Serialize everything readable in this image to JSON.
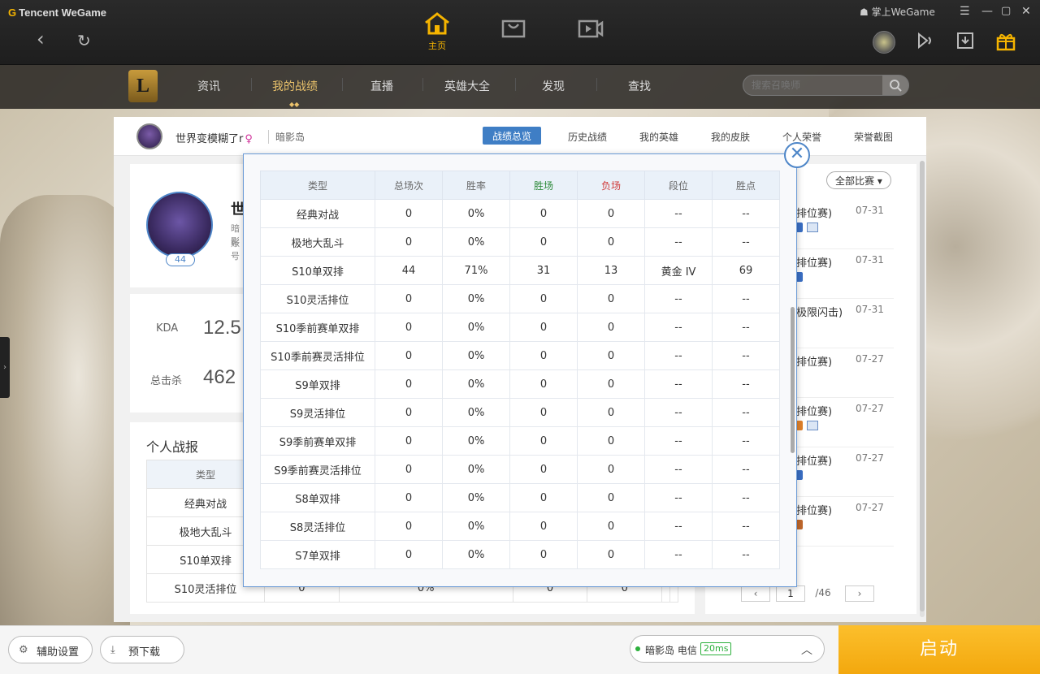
{
  "app": {
    "title": "Tencent WeGame",
    "brand_color": "#f5b400"
  },
  "topnav": {
    "home_label": "主页",
    "user_label": "掌上WeGame"
  },
  "lolnav": {
    "logo_letter": "L",
    "items": [
      "资讯",
      "我的战绩",
      "直播",
      "英雄大全",
      "发现",
      "查找"
    ],
    "active": "我的战绩",
    "search_placeholder": "搜索召唤师"
  },
  "profile": {
    "name": "世界变模糊了r",
    "gender_symbol": "♀",
    "server": "暗影岛",
    "level": "44",
    "name_partial": "世",
    "server_partial": "暗影",
    "account_partial": "账号"
  },
  "subtabs": [
    "战绩总览",
    "历史战绩",
    "我的英雄",
    "我的皮肤",
    "个人荣誉",
    "荣誉截图"
  ],
  "stats": {
    "kda_label": "KDA",
    "kda_value": "12.5",
    "kills_label": "总击杀",
    "kills_value": "462"
  },
  "report": {
    "title": "个人战报",
    "header": "类型",
    "rows": [
      {
        "type": "经典对战",
        "c1": "",
        "c2": "",
        "c3": "",
        "c4": "",
        "c5": "",
        "c6": ""
      },
      {
        "type": "极地大乱斗",
        "c1": "",
        "c2": "",
        "c3": "",
        "c4": "",
        "c5": "",
        "c6": ""
      },
      {
        "type": "S10单双排",
        "c1": "",
        "c2": "",
        "c3": "",
        "c4": "",
        "c5": "",
        "c6": ""
      },
      {
        "type": "S10灵活排位",
        "c1": "0",
        "c2": "0%",
        "c3": "0",
        "c4": "0",
        "c5": "",
        "c6": ""
      }
    ]
  },
  "matches": {
    "filter": "全部比赛",
    "rows": [
      {
        "mode": "排位赛)",
        "date": "07-31",
        "tag_color": "#3a6fc4",
        "has_img": true
      },
      {
        "mode": "排位赛)",
        "date": "07-31",
        "tag_color": "#3a6fc4",
        "has_img": false
      },
      {
        "mode": "极限闪击)",
        "date": "07-31",
        "tag_color": "",
        "has_img": false
      },
      {
        "mode": "排位赛)",
        "date": "07-27",
        "tag_color": "",
        "has_img": false
      },
      {
        "mode": "排位赛)",
        "date": "07-27",
        "tag_color": "#e0822c",
        "has_img": true
      },
      {
        "mode": "排位赛)",
        "date": "07-27",
        "tag_color": "#3a6fc4",
        "has_img": false
      },
      {
        "mode": "排位赛)",
        "date": "07-27",
        "tag_color": "#c0682c",
        "has_img": false
      }
    ],
    "page": "1",
    "total": "/46"
  },
  "modal": {
    "headers": [
      "类型",
      "总场次",
      "胜率",
      "胜场",
      "负场",
      "段位",
      "胜点"
    ],
    "rows": [
      [
        "经典对战",
        "0",
        "0%",
        "0",
        "0",
        "--",
        "--"
      ],
      [
        "极地大乱斗",
        "0",
        "0%",
        "0",
        "0",
        "--",
        "--"
      ],
      [
        "S10单双排",
        "44",
        "71%",
        "31",
        "13",
        "黄金 IV",
        "69"
      ],
      [
        "S10灵活排位",
        "0",
        "0%",
        "0",
        "0",
        "--",
        "--"
      ],
      [
        "S10季前赛单双排",
        "0",
        "0%",
        "0",
        "0",
        "--",
        "--"
      ],
      [
        "S10季前赛灵活排位",
        "0",
        "0%",
        "0",
        "0",
        "--",
        "--"
      ],
      [
        "S9单双排",
        "0",
        "0%",
        "0",
        "0",
        "--",
        "--"
      ],
      [
        "S9灵活排位",
        "0",
        "0%",
        "0",
        "0",
        "--",
        "--"
      ],
      [
        "S9季前赛单双排",
        "0",
        "0%",
        "0",
        "0",
        "--",
        "--"
      ],
      [
        "S9季前赛灵活排位",
        "0",
        "0%",
        "0",
        "0",
        "--",
        "--"
      ],
      [
        "S8单双排",
        "0",
        "0%",
        "0",
        "0",
        "--",
        "--"
      ],
      [
        "S8灵活排位",
        "0",
        "0%",
        "0",
        "0",
        "--",
        "--"
      ],
      [
        "S7单双排",
        "0",
        "0%",
        "0",
        "0",
        "--",
        "--"
      ]
    ],
    "close_symbol": "✕"
  },
  "bottom": {
    "assist_label": "辅助设置",
    "predownload_label": "预下载",
    "server": "暗影岛 电信",
    "ping": "20ms",
    "launch_label": "启动"
  }
}
